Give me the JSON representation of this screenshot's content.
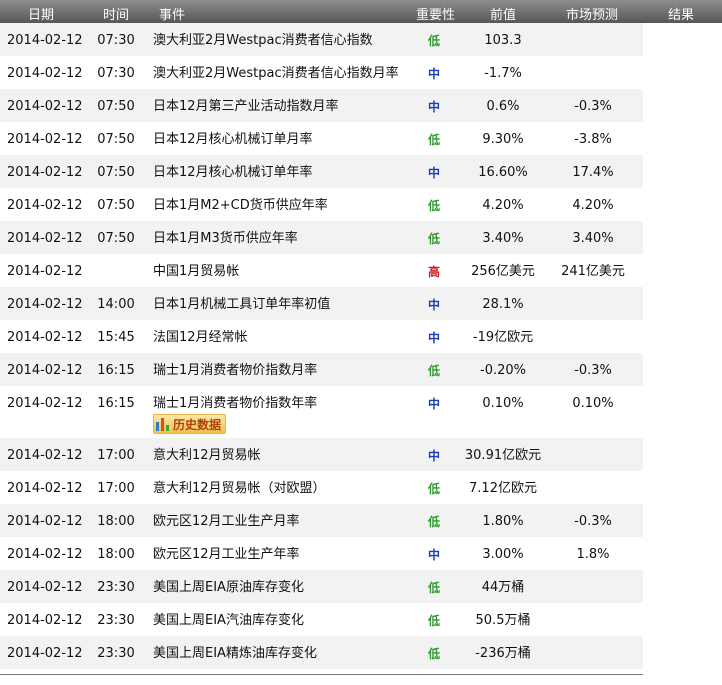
{
  "header": {
    "date": "日期",
    "time": "时间",
    "event": "事件",
    "importance": "重要性",
    "previous": "前值",
    "forecast": "市场预测",
    "result": "结果"
  },
  "history_button": {
    "label": "历史数据",
    "icon": "bar-chart-icon"
  },
  "colors": {
    "low": "#2e9b2e",
    "mid": "#1740b8",
    "high": "#d11a1a"
  },
  "rows": [
    {
      "date": "2014-02-12",
      "time": "07:30",
      "event": "澳大利亚2月Westpac消费者信心指数",
      "importance": "低",
      "level": "low",
      "previous": "103.3",
      "forecast": "",
      "result": ""
    },
    {
      "date": "2014-02-12",
      "time": "07:30",
      "event": "澳大利亚2月Westpac消费者信心指数月率",
      "importance": "中",
      "level": "mid",
      "previous": "-1.7%",
      "forecast": "",
      "result": ""
    },
    {
      "date": "2014-02-12",
      "time": "07:50",
      "event": "日本12月第三产业活动指数月率",
      "importance": "中",
      "level": "mid",
      "previous": "0.6%",
      "forecast": "-0.3%",
      "result": ""
    },
    {
      "date": "2014-02-12",
      "time": "07:50",
      "event": "日本12月核心机械订单月率",
      "importance": "低",
      "level": "low",
      "previous": "9.30%",
      "forecast": "-3.8%",
      "result": ""
    },
    {
      "date": "2014-02-12",
      "time": "07:50",
      "event": "日本12月核心机械订单年率",
      "importance": "中",
      "level": "mid",
      "previous": "16.60%",
      "forecast": "17.4%",
      "result": ""
    },
    {
      "date": "2014-02-12",
      "time": "07:50",
      "event": "日本1月M2+CD货币供应年率",
      "importance": "低",
      "level": "low",
      "previous": "4.20%",
      "forecast": "4.20%",
      "result": ""
    },
    {
      "date": "2014-02-12",
      "time": "07:50",
      "event": "日本1月M3货币供应年率",
      "importance": "低",
      "level": "low",
      "previous": "3.40%",
      "forecast": "3.40%",
      "result": ""
    },
    {
      "date": "2014-02-12",
      "time": "",
      "event": "中国1月贸易帐",
      "importance": "高",
      "level": "high",
      "previous": "256亿美元",
      "forecast": "241亿美元",
      "result": ""
    },
    {
      "date": "2014-02-12",
      "time": "14:00",
      "event": "日本1月机械工具订单年率初值",
      "importance": "中",
      "level": "mid",
      "previous": "28.1%",
      "forecast": "",
      "result": ""
    },
    {
      "date": "2014-02-12",
      "time": "15:45",
      "event": "法国12月经常帐",
      "importance": "中",
      "level": "mid",
      "previous": "-19亿欧元",
      "forecast": "",
      "result": ""
    },
    {
      "date": "2014-02-12",
      "time": "16:15",
      "event": "瑞士1月消费者物价指数月率",
      "importance": "低",
      "level": "low",
      "previous": "-0.20%",
      "forecast": "-0.3%",
      "result": ""
    },
    {
      "date": "2014-02-12",
      "time": "16:15",
      "event": "瑞士1月消费者物价指数年率",
      "importance": "中",
      "level": "mid",
      "previous": "0.10%",
      "forecast": "0.10%",
      "result": "",
      "has_history": true
    },
    {
      "date": "2014-02-12",
      "time": "17:00",
      "event": "意大利12月贸易帐",
      "importance": "中",
      "level": "mid",
      "previous": "30.91亿欧元",
      "forecast": "",
      "result": ""
    },
    {
      "date": "2014-02-12",
      "time": "17:00",
      "event": "意大利12月贸易帐（对欧盟）",
      "importance": "低",
      "level": "low",
      "previous": "7.12亿欧元",
      "forecast": "",
      "result": ""
    },
    {
      "date": "2014-02-12",
      "time": "18:00",
      "event": "欧元区12月工业生产月率",
      "importance": "低",
      "level": "low",
      "previous": "1.80%",
      "forecast": "-0.3%",
      "result": ""
    },
    {
      "date": "2014-02-12",
      "time": "18:00",
      "event": "欧元区12月工业生产年率",
      "importance": "中",
      "level": "mid",
      "previous": "3.00%",
      "forecast": "1.8%",
      "result": ""
    },
    {
      "date": "2014-02-12",
      "time": "23:30",
      "event": "美国上周EIA原油库存变化",
      "importance": "低",
      "level": "low",
      "previous": "44万桶",
      "forecast": "",
      "result": ""
    },
    {
      "date": "2014-02-12",
      "time": "23:30",
      "event": "美国上周EIA汽油库存变化",
      "importance": "低",
      "level": "low",
      "previous": "50.5万桶",
      "forecast": "",
      "result": ""
    },
    {
      "date": "2014-02-12",
      "time": "23:30",
      "event": "美国上周EIA精炼油库存变化",
      "importance": "低",
      "level": "low",
      "previous": "-236万桶",
      "forecast": "",
      "result": ""
    }
  ]
}
